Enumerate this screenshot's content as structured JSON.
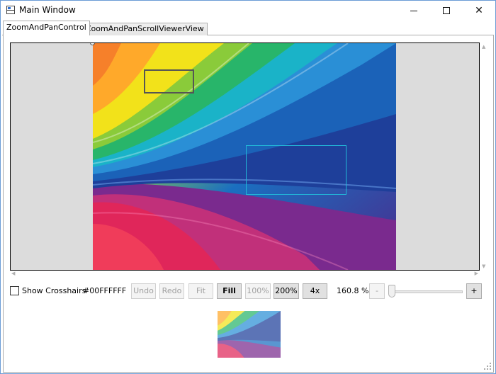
{
  "window": {
    "title": "Main Window",
    "icon": "app-window-icon",
    "controls": {
      "minimize_icon": "minimize-icon",
      "maximize_icon": "maximize-icon",
      "close_glyph": "✕"
    }
  },
  "tabs": [
    {
      "label": "ZoomAndPanControl",
      "active": true
    },
    {
      "label": "ZoomAndPanScrollViewerView",
      "active": false
    }
  ],
  "viewer": {
    "image": "rainbow-swirl-image",
    "zoom_rect_color": "#555555",
    "viewport_rect_color": "#22b7d8"
  },
  "scrollbars": {
    "up_glyph": "▲",
    "down_glyph": "▼",
    "left_glyph": "◀",
    "right_glyph": "▶"
  },
  "toolbar": {
    "show_crosshairs_label": "Show Crosshairs",
    "show_crosshairs_checked": false,
    "color_value": "#00FFFFFF",
    "undo_label": "Undo",
    "redo_label": "Redo",
    "fit_label": "Fit",
    "fill_label": "Fill",
    "zoom100_label": "100%",
    "zoom200_label": "200%",
    "zoom4x_label": "4x",
    "zoom_level": "160.8 %",
    "zoom_out_label": "-",
    "zoom_in_label": "+",
    "slider_fraction": 0.02
  },
  "colors": {
    "window_border": "#6b9bd6",
    "viewer_background": "#dcdcdc",
    "button_background": "#e1e1e1"
  }
}
